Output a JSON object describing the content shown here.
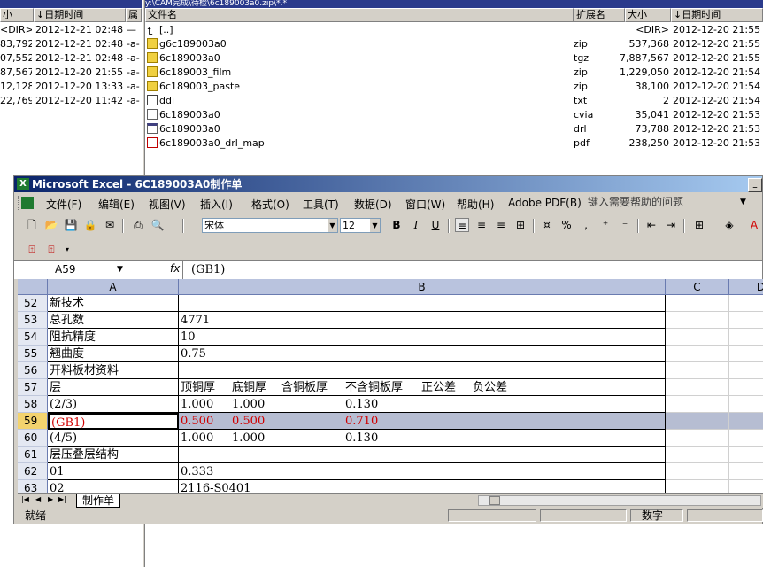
{
  "file_manager": {
    "left_panel": {
      "headers": {
        "size": "小",
        "date": "↓日期时间",
        "attr": "属"
      },
      "rows": [
        {
          "size": "<DIR>",
          "date": "2012-12-21 02:48",
          "attr": "—"
        },
        {
          "size": "83,792",
          "date": "2012-12-21 02:48",
          "attr": "-a-"
        },
        {
          "size": "07,552",
          "date": "2012-12-21 02:48",
          "attr": "-a-"
        },
        {
          "size": "87,567",
          "date": "2012-12-20 21:55",
          "attr": "-a-"
        },
        {
          "size": "12,128",
          "date": "2012-12-20 13:33",
          "attr": "-a-"
        },
        {
          "size": "22,769",
          "date": "2012-12-20 11:42",
          "attr": "-a-"
        }
      ]
    },
    "right_panel": {
      "path": "y:\\CAM完成\\待检\\6c189003a0.zip\\*.*",
      "headers": {
        "name": "文件名",
        "ext": "扩展名",
        "size": "大小",
        "date": "↓日期时间"
      },
      "rows": [
        {
          "icon": "up-icon",
          "name": "[..]",
          "ext": "",
          "size": "<DIR>",
          "date": "2012-12-20 21:55"
        },
        {
          "icon": "zip-icon",
          "name": "g6c189003a0",
          "ext": "zip",
          "size": "537,368",
          "date": "2012-12-20 21:55"
        },
        {
          "icon": "zip-icon",
          "name": "6c189003a0",
          "ext": "tgz",
          "size": "7,887,567",
          "date": "2012-12-20 21:55"
        },
        {
          "icon": "zip-icon",
          "name": "6c189003_film",
          "ext": "zip",
          "size": "1,229,050",
          "date": "2012-12-20 21:54"
        },
        {
          "icon": "zip-icon",
          "name": "6c189003_paste",
          "ext": "zip",
          "size": "38,100",
          "date": "2012-12-20 21:54"
        },
        {
          "icon": "txt-icon",
          "name": "ddi",
          "ext": "txt",
          "size": "2",
          "date": "2012-12-20 21:54"
        },
        {
          "icon": "file-icon",
          "name": "6c189003a0",
          "ext": "cvia",
          "size": "35,041",
          "date": "2012-12-20 21:53"
        },
        {
          "icon": "drl-icon",
          "name": "6c189003a0",
          "ext": "drl",
          "size": "73,788",
          "date": "2012-12-20 21:53"
        },
        {
          "icon": "pdf-icon",
          "name": "6c189003a0_drl_map",
          "ext": "pdf",
          "size": "238,250",
          "date": "2012-12-20 21:53"
        }
      ]
    }
  },
  "excel": {
    "title": "Microsoft Excel - 6C189003A0制作单",
    "menus": [
      "文件(F)",
      "编辑(E)",
      "视图(V)",
      "插入(I)",
      "格式(O)",
      "工具(T)",
      "数据(D)",
      "窗口(W)",
      "帮助(H)",
      "Adobe PDF(B)"
    ],
    "help_placeholder": "键入需要帮助的问题",
    "font_name": "宋体",
    "font_size": "12",
    "name_box": "A59",
    "fx_label": "fx",
    "formula": "(GB1)",
    "columns": [
      "A",
      "B",
      "C",
      "D"
    ],
    "rows": [
      {
        "num": "52",
        "a": "新技术",
        "b": ""
      },
      {
        "num": "53",
        "a": "总孔数",
        "b": "4771"
      },
      {
        "num": "54",
        "a": "阻抗精度",
        "b": "10"
      },
      {
        "num": "55",
        "a": "翘曲度",
        "b": "0.75"
      },
      {
        "num": "56",
        "a": "开料板材资料",
        "b": ""
      },
      {
        "num": "57",
        "a": "层",
        "b": [
          "顶铜厚",
          "底铜厚",
          "含铜板厚",
          "不含铜板厚",
          "正公差",
          "负公差"
        ]
      },
      {
        "num": "58",
        "a": "(2/3)",
        "b": [
          "1.000",
          "1.000",
          "",
          "0.130"
        ]
      },
      {
        "num": "59",
        "a": "(GB1)",
        "b": [
          "0.500",
          "0.500",
          "",
          "0.710"
        ],
        "selected": true
      },
      {
        "num": "60",
        "a": "(4/5)",
        "b": [
          "1.000",
          "1.000",
          "",
          "0.130"
        ]
      },
      {
        "num": "61",
        "a": "层压叠层结构",
        "b": ""
      },
      {
        "num": "62",
        "a": "01",
        "b": "0.333"
      },
      {
        "num": "63",
        "a": "02",
        "b": "2116-S0401"
      }
    ],
    "sheet_tab": "制作单",
    "status_ready": "就绪",
    "status_numlock": "数字"
  }
}
